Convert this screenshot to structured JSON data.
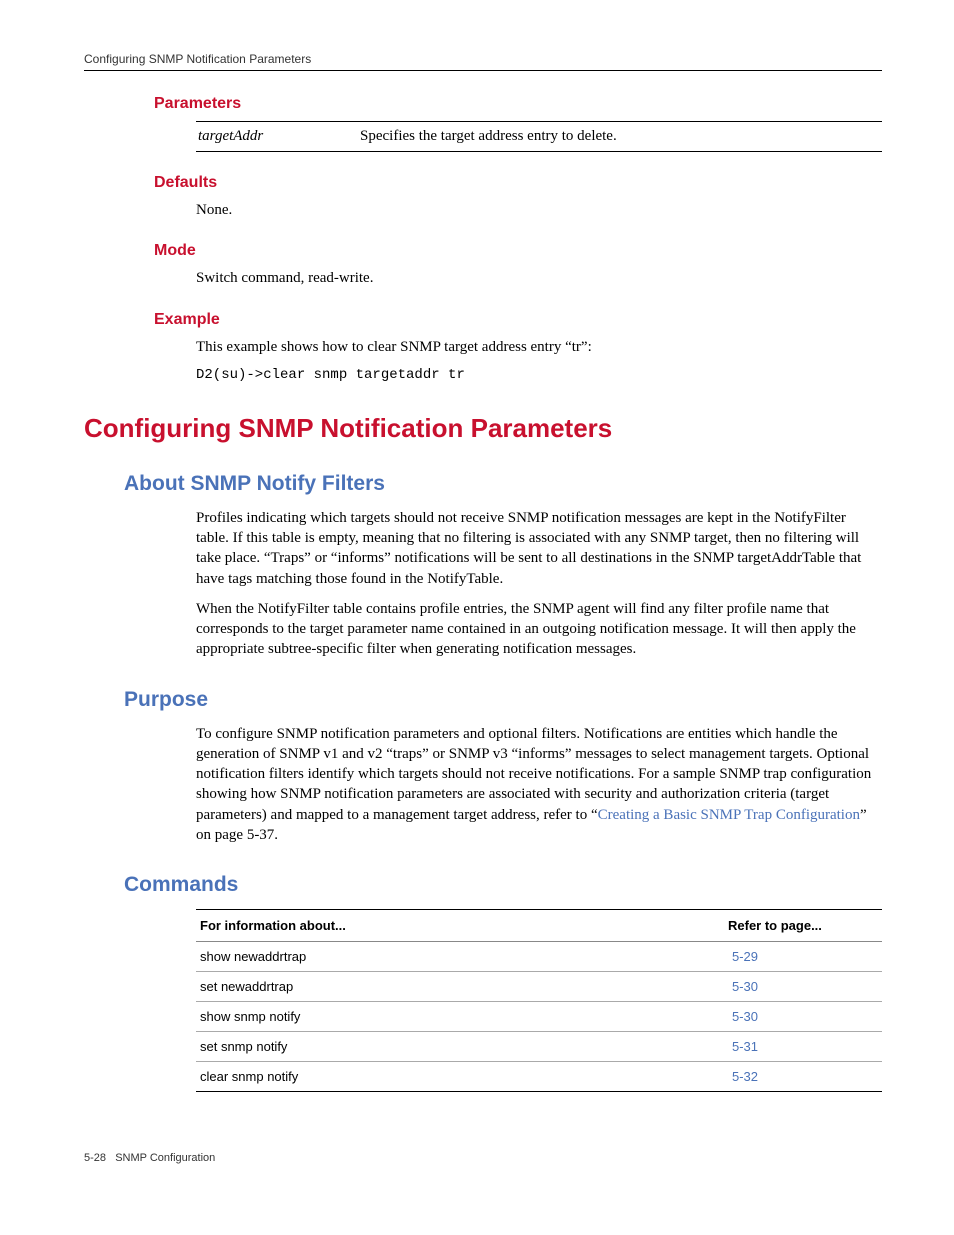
{
  "runningHead": "Configuring SNMP Notification Parameters",
  "sections": {
    "parameters": {
      "title": "Parameters",
      "name": "targetAddr",
      "desc": "Specifies the target address entry to delete."
    },
    "defaults": {
      "title": "Defaults",
      "body": "None."
    },
    "mode": {
      "title": "Mode",
      "body": "Switch command, read-write."
    },
    "example": {
      "title": "Example",
      "body": "This example shows how to clear SNMP target address entry “tr”:",
      "code": "D2(su)->clear snmp targetaddr tr"
    }
  },
  "h1": "Configuring SNMP Notification Parameters",
  "about": {
    "title": "About SNMP Notify Filters",
    "p1": "Profiles indicating which targets should not receive SNMP notification messages are kept in the NotifyFilter table. If this table is empty, meaning that no filtering is associated with any SNMP target, then no filtering will take place. “Traps” or “informs” notifications will be sent to all destinations in the SNMP targetAddrTable that have tags matching those found in the NotifyTable.",
    "p2": "When the NotifyFilter table contains profile entries, the SNMP agent will find any filter profile name that corresponds to the target parameter name contained in an outgoing notification message. It will then apply the appropriate subtree-specific filter when generating notification messages."
  },
  "purpose": {
    "title": "Purpose",
    "pre": "To configure SNMP notification parameters and optional filters. Notifications are entities which handle the generation of SNMP v1 and v2 “traps” or SNMP v3 “informs” messages to select management targets. Optional notification filters identify which targets should not receive notifications. For a sample SNMP trap configuration showing how SNMP notification parameters are associated with security and authorization criteria (target parameters) and mapped to a management target address, refer to “",
    "link": "Creating a Basic SNMP Trap Configuration",
    "post": "” on page 5-37."
  },
  "commands": {
    "title": "Commands",
    "colInfo": "For information about...",
    "colPage": "Refer to page...",
    "rows": [
      {
        "cmd": "show newaddrtrap",
        "page": "5-29"
      },
      {
        "cmd": "set newaddrtrap",
        "page": "5-30"
      },
      {
        "cmd": "show snmp notify",
        "page": "5-30"
      },
      {
        "cmd": "set snmp notify",
        "page": "5-31"
      },
      {
        "cmd": "clear snmp notify",
        "page": "5-32"
      }
    ]
  },
  "footer": {
    "pagenum": "5-28",
    "chapter": "SNMP Configuration"
  }
}
